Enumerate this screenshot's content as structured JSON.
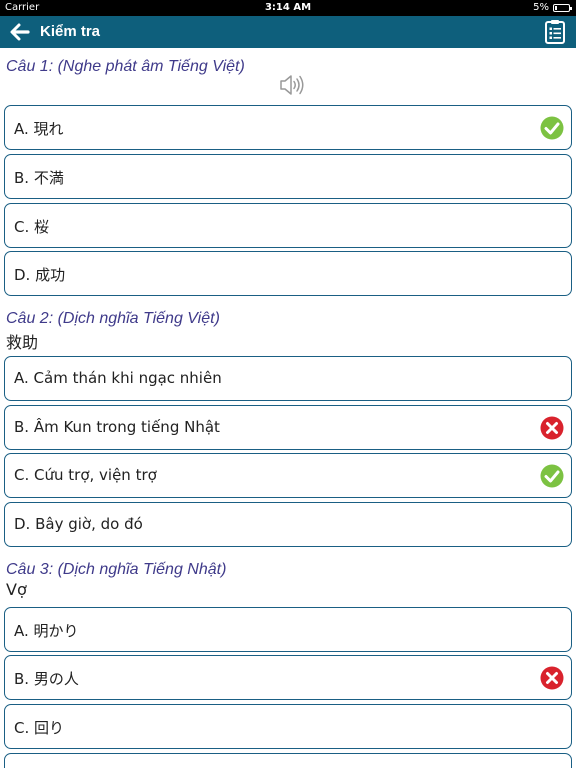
{
  "status_bar": {
    "carrier": "Carrier",
    "time": "3:14 AM",
    "battery": "5%"
  },
  "nav": {
    "title": "Kiểm tra",
    "back_icon": "back-arrow-icon",
    "menu_icon": "clipboard-list-icon"
  },
  "questions": [
    {
      "title": "Câu 1: (Nghe phát âm Tiếng Việt)",
      "prompt": "",
      "has_audio": true,
      "options": [
        {
          "label": "A. 現れ",
          "mark": "correct"
        },
        {
          "label": "B. 不満",
          "mark": ""
        },
        {
          "label": "C. 桜",
          "mark": ""
        },
        {
          "label": "D. 成功",
          "mark": ""
        }
      ]
    },
    {
      "title": "Câu 2: (Dịch nghĩa Tiếng Việt)",
      "prompt": "救助",
      "options": [
        {
          "label": "A. Cảm thán khi ngạc nhiên",
          "mark": ""
        },
        {
          "label": "B. Âm Kun trong tiếng Nhật",
          "mark": "wrong"
        },
        {
          "label": "C. Cứu trợ, viện trợ",
          "mark": "correct"
        },
        {
          "label": "D. Bây giờ, do đó",
          "mark": ""
        }
      ]
    },
    {
      "title": "Câu 3: (Dịch nghĩa Tiếng Nhật)",
      "prompt": "Vợ",
      "options": [
        {
          "label": "A. 明かり",
          "mark": ""
        },
        {
          "label": "B. 男の人",
          "mark": "wrong"
        },
        {
          "label": "C. 回り",
          "mark": ""
        },
        {
          "label": "",
          "mark": ""
        }
      ]
    }
  ],
  "colors": {
    "nav": "#0e5f7c",
    "question_title": "#3f3a8a",
    "option_border": "#1a5f84",
    "correct": "#7cc242",
    "wrong": "#d9232d"
  }
}
